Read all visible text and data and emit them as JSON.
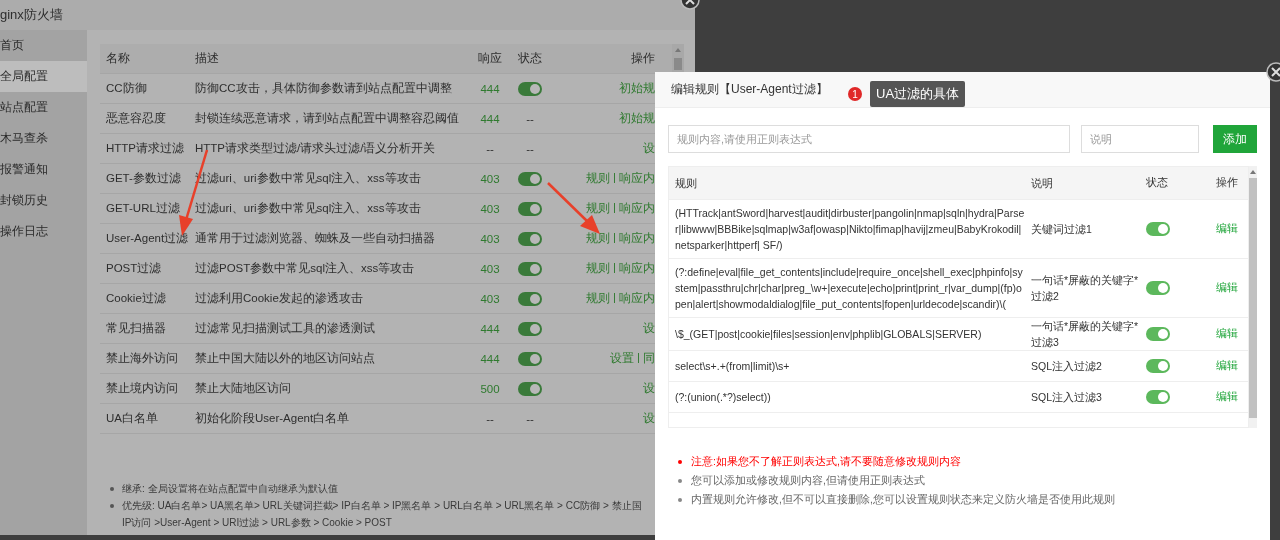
{
  "window": {
    "title": "ginx防火墙"
  },
  "sidebar": {
    "items": [
      {
        "label": "首页",
        "selected": false
      },
      {
        "label": "全局配置",
        "selected": true
      },
      {
        "label": "站点配置",
        "selected": false
      },
      {
        "label": "木马查杀",
        "selected": false
      },
      {
        "label": "报警通知",
        "selected": false
      },
      {
        "label": "封锁历史",
        "selected": false
      },
      {
        "label": "操作日志",
        "selected": false
      }
    ]
  },
  "table": {
    "columns": [
      "名称",
      "描述",
      "响应",
      "状态",
      "操作"
    ],
    "rows": [
      {
        "name": "CC防御",
        "description": "防御CC攻击，具体防御参数请到站点配置中调整",
        "response": "444",
        "status": {
          "kind": "toggle",
          "on": true
        },
        "actions": [
          "初始规"
        ]
      },
      {
        "name": "恶意容忍度",
        "description": "封锁连续恶意请求，请到站点配置中调整容忍阈值",
        "response": "444",
        "status": {
          "kind": "text",
          "text": "--"
        },
        "actions": [
          "初始规"
        ]
      },
      {
        "name": "HTTP请求过滤",
        "description": "HTTP请求类型过滤/请求头过滤/语义分析开关",
        "response": "--",
        "status": {
          "kind": "text",
          "text": "--"
        },
        "actions": [
          "设"
        ]
      },
      {
        "name": "GET-参数过滤",
        "description": "过滤uri、uri参数中常见sql注入、xss等攻击",
        "response": "403",
        "status": {
          "kind": "toggle",
          "on": true
        },
        "actions": [
          "规则",
          "|",
          "响应内"
        ]
      },
      {
        "name": "GET-URL过滤",
        "description": "过滤uri、uri参数中常见sql注入、xss等攻击",
        "response": "403",
        "status": {
          "kind": "toggle",
          "on": true
        },
        "actions": [
          "规则",
          "|",
          "响应内"
        ]
      },
      {
        "name": "User-Agent过滤",
        "description": "通常用于过滤浏览器、蜘蛛及一些自动扫描器",
        "response": "403",
        "status": {
          "kind": "toggle",
          "on": true
        },
        "actions": [
          "规则",
          "|",
          "响应内"
        ]
      },
      {
        "name": "POST过滤",
        "description": "过滤POST参数中常见sql注入、xss等攻击",
        "response": "403",
        "status": {
          "kind": "toggle",
          "on": true
        },
        "actions": [
          "规则",
          "|",
          "响应内"
        ]
      },
      {
        "name": "Cookie过滤",
        "description": "过滤利用Cookie发起的渗透攻击",
        "response": "403",
        "status": {
          "kind": "toggle",
          "on": true
        },
        "actions": [
          "规则",
          "|",
          "响应内"
        ]
      },
      {
        "name": "常见扫描器",
        "description": "过滤常见扫描测试工具的渗透测试",
        "response": "444",
        "status": {
          "kind": "toggle",
          "on": true
        },
        "actions": [
          "设"
        ]
      },
      {
        "name": "禁止海外访问",
        "description": "禁止中国大陆以外的地区访问站点",
        "response": "444",
        "status": {
          "kind": "toggle",
          "on": true
        },
        "actions": [
          "设置",
          "|",
          "同"
        ]
      },
      {
        "name": "禁止境内访问",
        "description": "禁止大陆地区访问",
        "response": "500",
        "status": {
          "kind": "toggle",
          "on": true
        },
        "actions": [
          "设"
        ]
      },
      {
        "name": "UA白名单",
        "description": "初始化阶段User-Agent白名单",
        "response": "--",
        "status": {
          "kind": "text",
          "text": "--"
        },
        "actions": [
          "设"
        ]
      }
    ]
  },
  "notes": [
    {
      "lines": [
        "继承: 全局设置将在站点配置中自动继承为默认值"
      ]
    },
    {
      "lines": [
        "优先级: UA白名单> UA黑名单> URL关键词拦截> IP白名单 > IP黑名单 > URL白名单 > URL黑名单 > CC防御 > 禁止国",
        "IP访问 >User-Agent > URI过滤 > URL参数 > Cookie > POST"
      ]
    }
  ],
  "annotation": {
    "number": "1",
    "text": "UA过滤的具体"
  },
  "dialog": {
    "title": "编辑规则【User-Agent过滤】",
    "rule_field": {
      "placeholder": "规则内容,请使用正则表达式"
    },
    "note_field": {
      "placeholder": "说明"
    },
    "add_button": "添加",
    "columns": [
      "规则",
      "说明",
      "状态",
      "操作"
    ],
    "rows": [
      {
        "rule": "(HTTrack|antSword|harvest|audit|dirbuster|pangolin|nmap|sqln|hydra|Parser|libwww|BBBike|sqlmap|w3af|owasp|Nikto|fimap|havij|zmeu|BabyKrokodil|netsparker|httperf| SF/)",
        "note": "关键词过滤1",
        "on": true,
        "action": "编辑"
      },
      {
        "rule": "(?:define|eval|file_get_contents|include|require_once|shell_exec|phpinfo|system|passthru|chr|char|preg_\\w+|execute|echo|print|print_r|var_dump|(fp)open|alert|showmodaldialog|file_put_contents|fopen|urldecode|scandir)\\(",
        "note": "一句话*屏蔽的关键字*过滤2",
        "on": true,
        "action": "编辑"
      },
      {
        "rule": "\\$_(GET|post|cookie|files|session|env|phplib|GLOBALS|SERVER)",
        "note": "一句话*屏蔽的关键字*过滤3",
        "on": true,
        "action": "编辑"
      },
      {
        "rule": "select\\s+.+(from|limit)\\s+",
        "note": "SQL注入过滤2",
        "on": true,
        "action": "编辑"
      },
      {
        "rule": "(?:(union(.*?)select))",
        "note": "SQL注入过滤3",
        "on": true,
        "action": "编辑"
      }
    ],
    "notes": [
      {
        "kind": "warning",
        "text": "注意:如果您不了解正则表达式,请不要随意修改规则内容"
      },
      {
        "kind": "info",
        "text": "您可以添加或修改规则内容,但请使用正则表达式"
      },
      {
        "kind": "info",
        "text": "内置规则允许修改,但不可以直接删除,您可以设置规则状态来定义防火墙是否使用此规则"
      }
    ]
  }
}
